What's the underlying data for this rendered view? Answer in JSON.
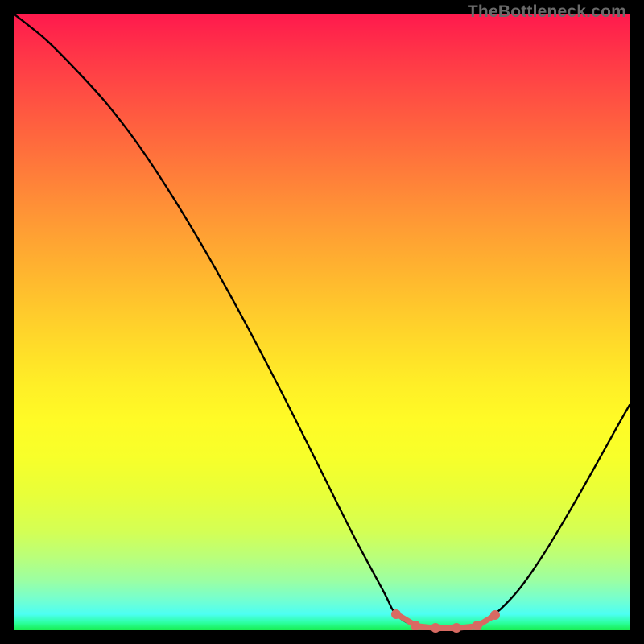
{
  "watermark": "TheBottleneck.com",
  "chart_data": {
    "type": "line",
    "title": "",
    "xlabel": "",
    "ylabel": "",
    "xlim": [
      0,
      100
    ],
    "ylim": [
      0,
      100
    ],
    "background_gradient": {
      "top_color": "#ff1a4d",
      "mid_color": "#ffee27",
      "bottom_color": "#1aee55"
    },
    "series": [
      {
        "name": "bottleneck-curve",
        "x": [
          0,
          5,
          10,
          15,
          20,
          25,
          30,
          35,
          40,
          45,
          50,
          55,
          60,
          62,
          65,
          68,
          72,
          75,
          78,
          82,
          86,
          90,
          94,
          98,
          100
        ],
        "y": [
          100,
          96,
          91,
          85.5,
          79,
          71.5,
          63.3,
          54.5,
          45.2,
          35.5,
          25.5,
          15.5,
          6.2,
          2.5,
          0.6,
          0.2,
          0.2,
          0.6,
          2.4,
          6.5,
          12.2,
          18.8,
          25.8,
          33,
          36.5
        ]
      }
    ],
    "highlight": {
      "name": "optimal-range",
      "points_x": [
        62.0,
        65.2,
        68.5,
        71.8,
        75.2,
        78.2
      ],
      "points_y": [
        2.5,
        0.6,
        0.22,
        0.22,
        0.6,
        2.4
      ],
      "color": "#d86a62"
    }
  }
}
